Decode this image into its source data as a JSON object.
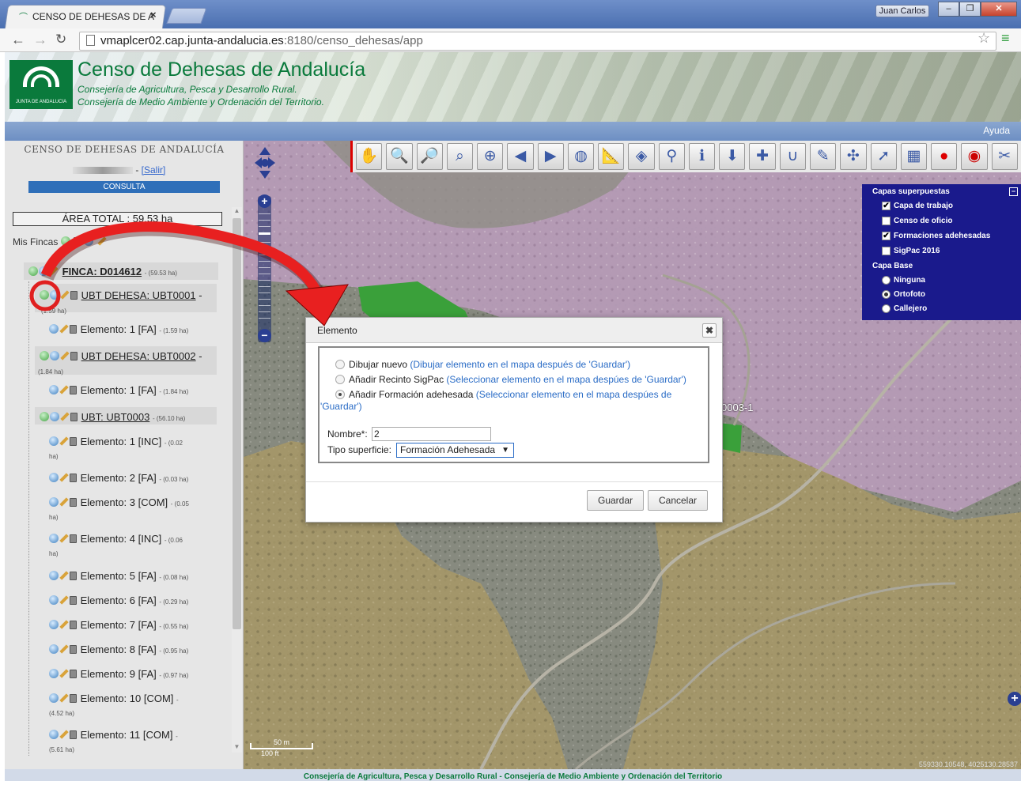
{
  "browser": {
    "tab_title": "CENSO DE DEHESAS DE A",
    "user_button": "Juan Carlos",
    "url_host": "vmaplcer02.cap.junta-andalucia.es",
    "url_rest": ":8180/censo_dehesas/app"
  },
  "header": {
    "logo_text": "JUNTA DE ANDALUCIA",
    "title": "Censo de Dehesas de Andalucía",
    "subtitle1": "Consejería de Agricultura, Pesca y Desarrollo Rural.",
    "subtitle2": "Consejería de Medio Ambiente y Ordenación del Territorio.",
    "help_link": "Ayuda"
  },
  "sidebar": {
    "title": "CENSO DE DEHESAS DE ANDALUCÍA",
    "logout": "[Salir]",
    "mode_badge": "CONSULTA",
    "total_area": "ÁREA TOTAL : 59.53 ha",
    "fincas_label": "Mis Fincas",
    "finca": {
      "label": "FINCA: D014612",
      "size": "- (59.53 ha)"
    },
    "ubts": [
      {
        "label": "UBT DEHESA: UBT0001",
        "size": "(1.59 ha)"
      },
      {
        "label": "UBT DEHESA: UBT0002",
        "size": "(1.84 ha)"
      },
      {
        "label": "UBT: UBT0003",
        "size": "- (56.10 ha)"
      }
    ],
    "elements": [
      {
        "label": "Elemento: 1 [FA]",
        "size": "- (1.59 ha)"
      },
      {
        "label": "Elemento: 1 [FA]",
        "size": "- (1.84 ha)"
      },
      {
        "label": "Elemento: 1 [INC]",
        "size": "- (0.02",
        "size2": "ha)"
      },
      {
        "label": "Elemento: 2 [FA]",
        "size": "- (0.03 ha)"
      },
      {
        "label": "Elemento: 3 [COM]",
        "size": "- (0.05",
        "size2": "ha)"
      },
      {
        "label": "Elemento: 4 [INC]",
        "size": "- (0.06",
        "size2": "ha)"
      },
      {
        "label": "Elemento: 5 [FA]",
        "size": "- (0.08 ha)"
      },
      {
        "label": "Elemento: 6 [FA]",
        "size": "- (0.29 ha)"
      },
      {
        "label": "Elemento: 7 [FA]",
        "size": "- (0.55 ha)"
      },
      {
        "label": "Elemento: 8 [FA]",
        "size": "- (0.95 ha)"
      },
      {
        "label": "Elemento: 9 [FA]",
        "size": "- (0.97 ha)"
      },
      {
        "label": "Elemento: 10 [COM]",
        "size": "-",
        "size2": "(4.52 ha)"
      },
      {
        "label": "Elemento: 11 [COM]",
        "size": "-",
        "size2": "(5.61 ha)"
      }
    ]
  },
  "layers": {
    "overlay_title": "Capas superpuestas",
    "overlays": [
      {
        "label": "Capa de trabajo",
        "checked": true
      },
      {
        "label": "Censo de oficio",
        "checked": false
      },
      {
        "label": "Formaciones adehesadas",
        "checked": true
      },
      {
        "label": "SigPac 2016",
        "checked": false
      }
    ],
    "base_title": "Capa Base",
    "bases": [
      {
        "label": "Ninguna",
        "selected": false
      },
      {
        "label": "Ortofoto",
        "selected": true
      },
      {
        "label": "Callejero",
        "selected": false
      }
    ]
  },
  "map": {
    "feature_label": "0003-1",
    "scale_m": "50 m",
    "scale_ft": "100 ft",
    "coords": "559330.10548, 4025130.28587",
    "toolbar_icons": [
      "hand-pan-icon",
      "zoom-in-icon",
      "zoom-out-icon",
      "zoom-box-icon",
      "zoom-extent-icon",
      "previous-view-icon",
      "next-view-icon",
      "globe-icon",
      "measure-icon",
      "measure-area-icon",
      "magnifier-icon",
      "info-icon",
      "download-icon",
      "new-feature-icon",
      "magnet-icon",
      "edit-icon",
      "move-vertex-icon",
      "select-icon",
      "layer-edit-icon",
      "stop-icon",
      "record-icon",
      "cut-icon"
    ]
  },
  "dialog": {
    "title": "Elemento",
    "options": [
      {
        "label": "Dibujar nuevo",
        "hint": "(Dibujar elemento en el mapa después de 'Guardar')",
        "selected": false
      },
      {
        "label": "Añadir Recinto SigPac",
        "hint": "(Seleccionar elemento en el mapa despúes de 'Guardar')",
        "selected": false
      },
      {
        "label": "Añadir Formación adehesada",
        "hint": "(Seleccionar elemento en el mapa despúes de",
        "hint2": "'Guardar')",
        "selected": true
      }
    ],
    "name_label": "Nombre*:",
    "name_value": "2",
    "type_label": "Tipo superficie:",
    "type_value": "Formación Adehesada",
    "save": "Guardar",
    "cancel": "Cancelar"
  },
  "footer": "Consejería de Agricultura, Pesca y Desarrollo Rural - Consejería de Medio Ambiente y Ordenación del Territorio"
}
